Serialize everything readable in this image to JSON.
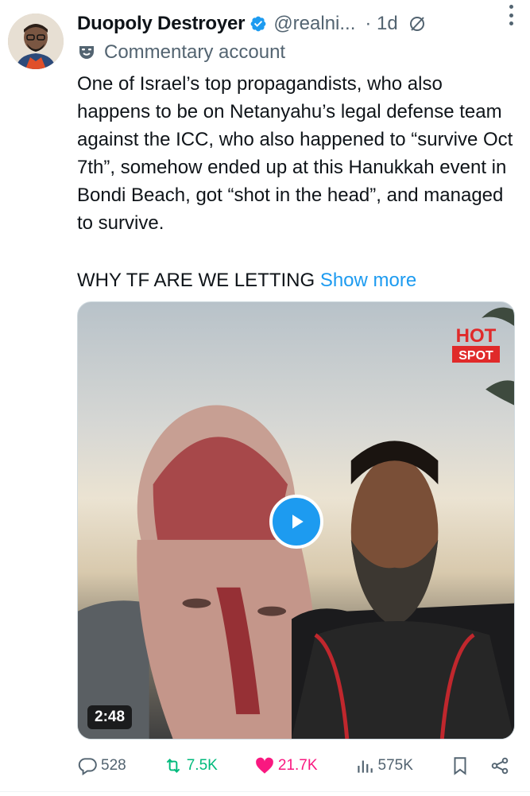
{
  "author": {
    "name": "Duopoly Destroyer",
    "handle": "@realni...",
    "time": "· 1d",
    "label": "Commentary account"
  },
  "tweet": {
    "text": "One of Israel’s top propagandists, who also happens to be on Netanyahu’s legal defense team against the ICC, who also happened to “survive Oct 7th”, somehow ended up at this Hanukkah event in Bondi Beach, got “shot in the head”, and managed to survive.",
    "text2": "WHY TF ARE WE LETTING",
    "show_more": "Show more"
  },
  "media": {
    "watermark_top": "HOT",
    "watermark_bottom": "SPOT",
    "duration": "2:48"
  },
  "actions": {
    "replies": "528",
    "retweets": "7.5K",
    "likes": "21.7K",
    "views": "575K"
  },
  "colors": {
    "accent": "#1d9bf0",
    "retweet": "#00ba7c",
    "like": "#f91880",
    "secondary_text": "#536471"
  }
}
